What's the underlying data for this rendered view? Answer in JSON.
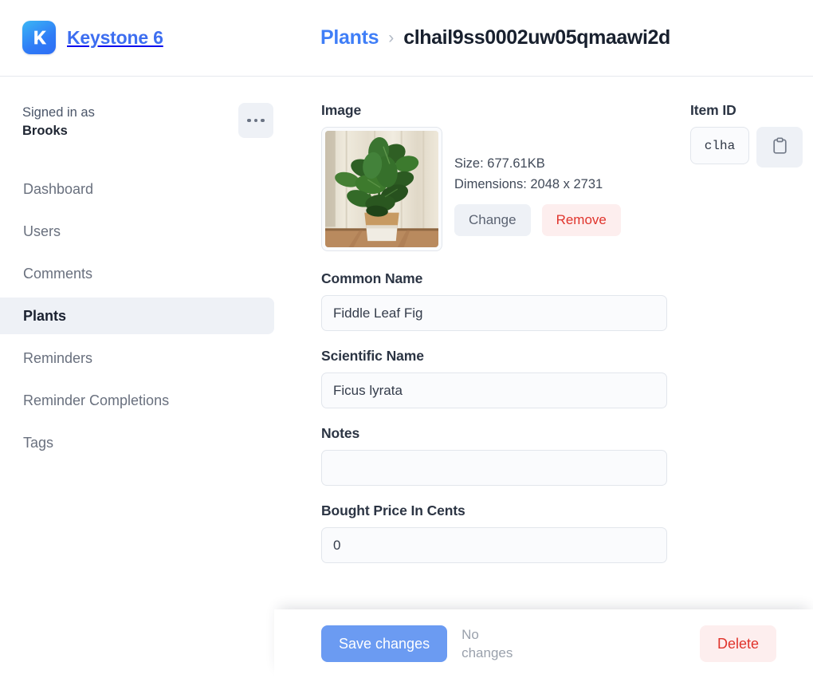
{
  "header": {
    "brand_name": "Keystone 6",
    "logo_letter": "K",
    "breadcrumb": {
      "parent": "Plants",
      "separator": "›",
      "current": "clhail9ss0002uw05qmaawi2d"
    }
  },
  "sidebar": {
    "signed_in_label": "Signed in as",
    "user_name": "Brooks",
    "more_menu": "...",
    "items": [
      {
        "label": "Dashboard",
        "active": false
      },
      {
        "label": "Users",
        "active": false
      },
      {
        "label": "Comments",
        "active": false
      },
      {
        "label": "Plants",
        "active": true
      },
      {
        "label": "Reminders",
        "active": false
      },
      {
        "label": "Reminder Completions",
        "active": false
      },
      {
        "label": "Tags",
        "active": false
      }
    ]
  },
  "main": {
    "image_field": {
      "label": "Image",
      "size_text": "Size: 677.61KB",
      "dimensions_text": "Dimensions: 2048 x 2731",
      "change_label": "Change",
      "remove_label": "Remove"
    },
    "fields": [
      {
        "label": "Common Name",
        "value": "Fiddle Leaf Fig",
        "placeholder": ""
      },
      {
        "label": "Scientific Name",
        "value": "Ficus lyrata",
        "placeholder": ""
      },
      {
        "label": "Notes",
        "value": "",
        "placeholder": ""
      },
      {
        "label": "Bought Price In Cents",
        "value": "0",
        "placeholder": ""
      }
    ]
  },
  "side_panel": {
    "item_id_label": "Item ID",
    "item_id_value": "clha",
    "copy_icon": "clipboard-icon"
  },
  "footer": {
    "save_label": "Save changes",
    "status_text": "No changes",
    "delete_label": "Delete"
  },
  "colors": {
    "brand_blue": "#3d6ef0",
    "link_blue": "#3f7ef7",
    "save_blue": "#6b9bf2",
    "danger_red": "#e0342c",
    "danger_bg": "#fdeeee",
    "neutral_bg": "#eef1f6",
    "input_bg": "#fafbfd",
    "border": "#e2e6ec"
  }
}
